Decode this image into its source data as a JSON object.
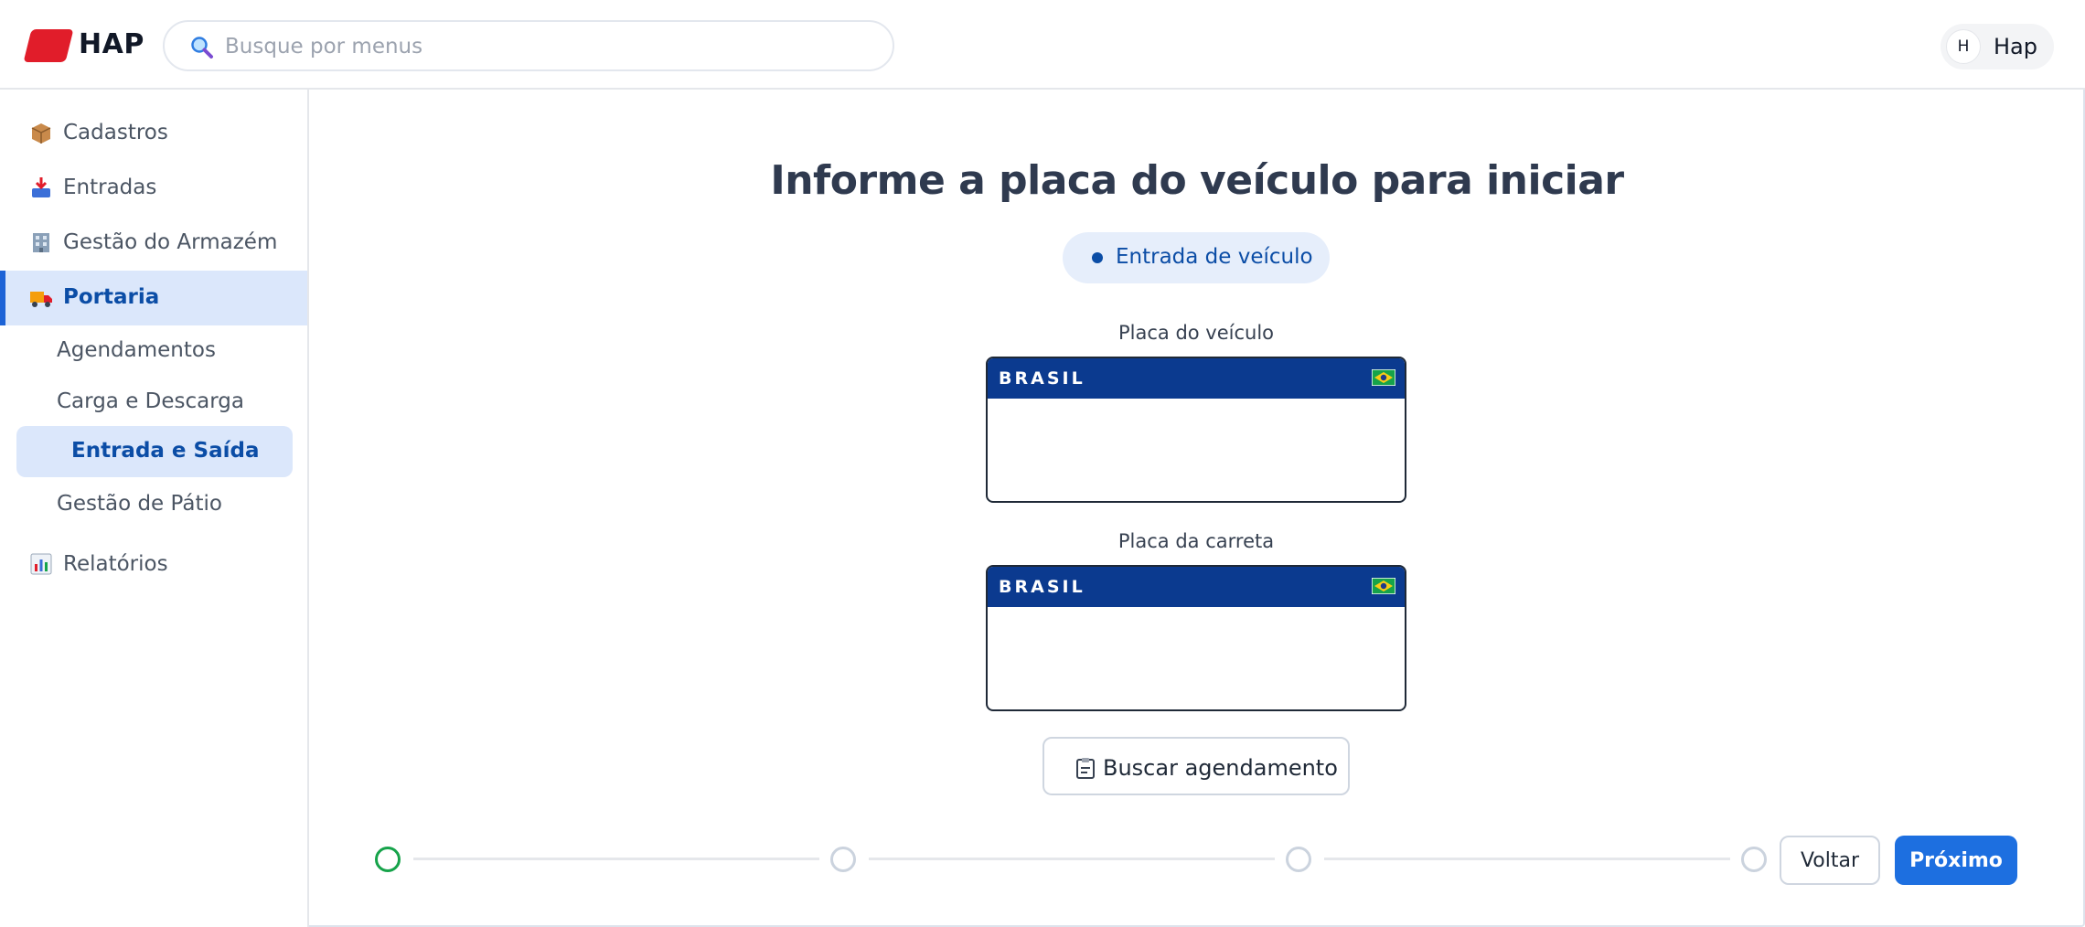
{
  "header": {
    "brand": "HAP",
    "search": {
      "placeholder": "Busque por menus",
      "value": ""
    },
    "user": {
      "initial": "H",
      "name": "Hap"
    }
  },
  "sidebar": {
    "items": [
      {
        "label": "Cadastros",
        "icon": "package-icon"
      },
      {
        "label": "Entradas",
        "icon": "inbox-tray-icon"
      },
      {
        "label": "Gestão do Armazém",
        "icon": "office-building-icon"
      },
      {
        "label": "Portaria",
        "icon": "delivery-truck-icon",
        "active": true
      },
      {
        "label": "Relatórios",
        "icon": "bar-chart-icon"
      }
    ],
    "portaria_sub": [
      {
        "label": "Agendamentos"
      },
      {
        "label": "Carga e Descarga"
      },
      {
        "label": "Entrada e Saída",
        "active": true
      },
      {
        "label": "Gestão de Pátio"
      }
    ]
  },
  "main": {
    "title": "Informe a placa do veículo para iniciar",
    "mode_pill": "Entrada de veículo",
    "vehicle_plate": {
      "label": "Placa do veículo",
      "country": "BRASIL",
      "value": ""
    },
    "trailer_plate": {
      "label": "Placa da carreta",
      "country": "BRASIL",
      "value": ""
    },
    "search_schedule_button": "Buscar agendamento"
  },
  "stepper": {
    "total_steps": 4,
    "current_step": 1
  },
  "footer": {
    "back_label": "Voltar",
    "next_label": "Próximo"
  },
  "colors": {
    "brand_red": "#e11d2a",
    "primary_blue": "#1d6fe0",
    "active_nav_bg": "#dbe7fb",
    "plate_blue": "#0b3a8f",
    "step_current": "#16a34a"
  }
}
